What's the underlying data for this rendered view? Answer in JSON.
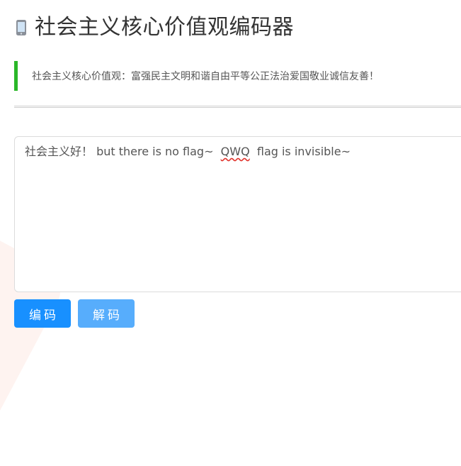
{
  "header": {
    "title": "社会主义核心价值观编码器",
    "icon": "phone-icon"
  },
  "notice": {
    "text": "社会主义核心价值观：富强民主文明和谐自由平等公正法治爱国敬业诚信友善！",
    "accent_color": "#2ab728"
  },
  "editor": {
    "text_before": "社会主义好！ but there is no flag~  ",
    "text_misspelled": "QWQ",
    "text_after": "  flag is invisible~"
  },
  "buttons": {
    "encode_label": "编码",
    "decode_label": "解码",
    "encode_color": "#1890ff",
    "decode_color": "#57adfc"
  }
}
